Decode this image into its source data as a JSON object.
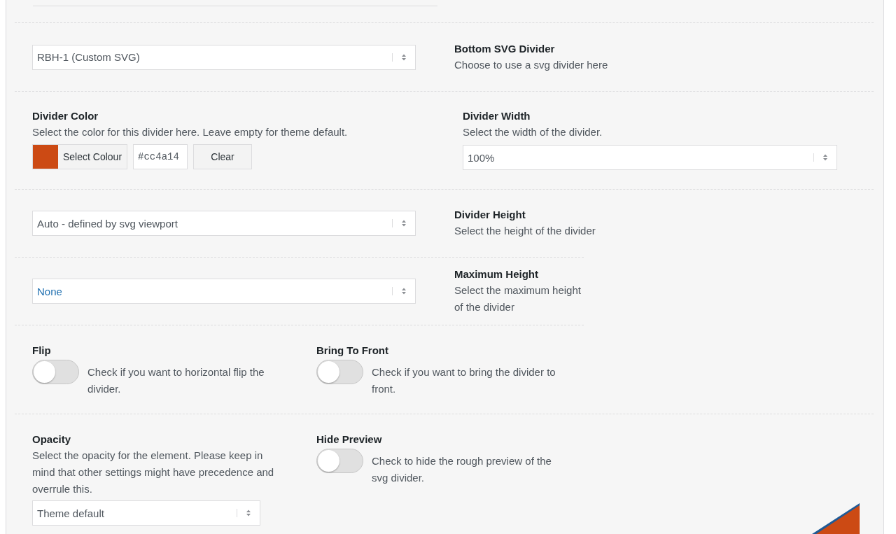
{
  "divider_select": {
    "value": "RBH-1 (Custom SVG)",
    "highlighted": false,
    "title": "Bottom SVG Divider",
    "description": "Choose to use a svg divider here"
  },
  "divider_color": {
    "title": "Divider Color",
    "description": "Select the color for this divider here. Leave empty for theme default.",
    "color": "#cc4a14",
    "button": "Select Colour",
    "value": "#cc4a14",
    "clear": "Clear"
  },
  "divider_width": {
    "title": "Divider Width",
    "description": "Select the width of the divider.",
    "value": "100%",
    "highlighted": false
  },
  "divider_height": {
    "value": "Auto - defined by svg viewport",
    "highlighted": false,
    "title": "Divider Height",
    "description": "Select the height of the divider"
  },
  "maximum_height": {
    "value": "None",
    "highlighted": true,
    "title": "Maximum Height",
    "description": "Select the maximum height of the divider"
  },
  "flip": {
    "title": "Flip",
    "on": false,
    "description": "Check if you want to horizontal flip the divider."
  },
  "bring_to_front": {
    "title": "Bring To Front",
    "on": false,
    "description": "Check if you want to bring the divider to front."
  },
  "opacity": {
    "title": "Opacity",
    "description": "Select the opacity for the element. Please keep in mind that other settings might have precedence and overrule this.",
    "value": "Theme default",
    "highlighted": false
  },
  "hide_preview": {
    "title": "Hide Preview",
    "on": false,
    "description": "Check to hide the rough preview of the svg divider."
  }
}
